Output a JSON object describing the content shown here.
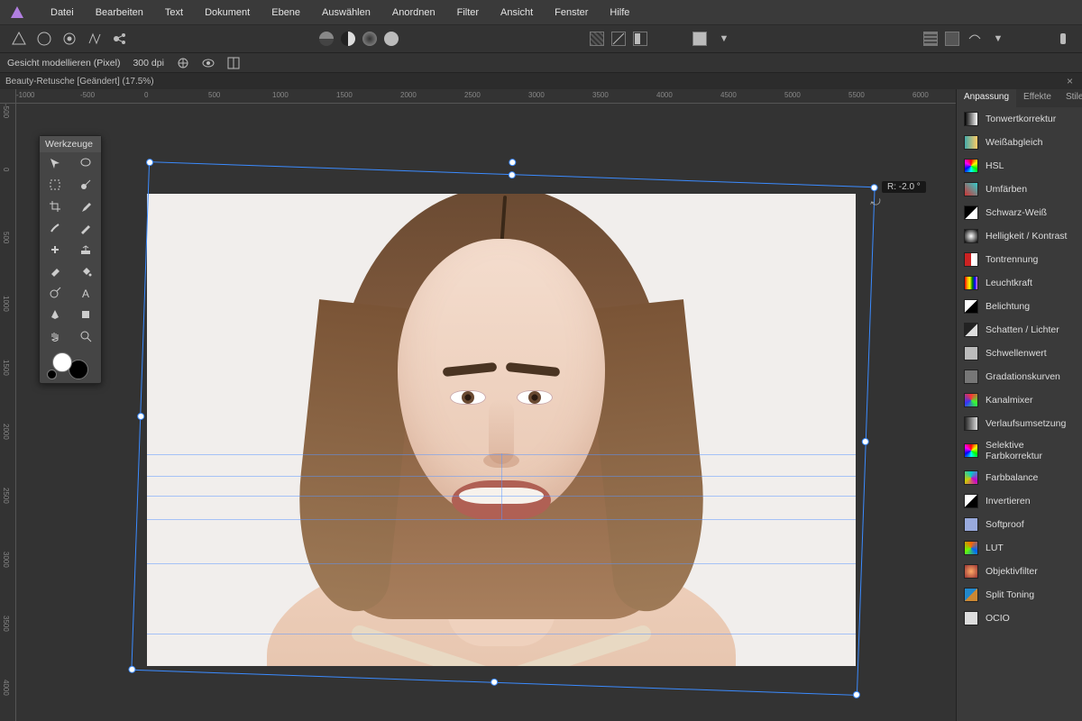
{
  "menu": {
    "items": [
      "Datei",
      "Bearbeiten",
      "Text",
      "Dokument",
      "Ebene",
      "Auswählen",
      "Anordnen",
      "Filter",
      "Ansicht",
      "Fenster",
      "Hilfe"
    ]
  },
  "context": {
    "label": "Gesicht modellieren (Pixel)",
    "dpi": "300 dpi"
  },
  "doc_tab": "Beauty-Retusche [Geändert] (17.5%)",
  "tools_panel_title": "Werkzeuge",
  "rotation_readout": "R:  -2.0 °",
  "ruler_h": [
    "-1000",
    "-500",
    "0",
    "500",
    "1000",
    "1500",
    "2000",
    "2500",
    "3000",
    "3500",
    "4000",
    "4500",
    "5000",
    "5500",
    "6000"
  ],
  "ruler_v": [
    "-500",
    "0",
    "500",
    "1000",
    "1500",
    "2000",
    "2500",
    "3000",
    "3500",
    "4000"
  ],
  "right_tabs": {
    "active": "Anpassung",
    "others": [
      "Effekte",
      "Stile"
    ]
  },
  "adjustments": [
    {
      "label": "Tonwertkorrektur",
      "iconColor": "linear-gradient(90deg,#000,#fff)"
    },
    {
      "label": "Weißabgleich",
      "iconColor": "linear-gradient(90deg,#4aa,#fc6)"
    },
    {
      "label": "HSL",
      "iconColor": "conic-gradient(red,yellow,lime,cyan,blue,magenta,red)"
    },
    {
      "label": "Umfärben",
      "iconColor": "linear-gradient(45deg,#c33,#3cc)"
    },
    {
      "label": "Schwarz-Weiß",
      "iconColor": "linear-gradient(135deg,#000 50%,#fff 50%)"
    },
    {
      "label": "Helligkeit / Kontrast",
      "iconColor": "radial-gradient(circle,#fff,#000)"
    },
    {
      "label": "Tontrennung",
      "iconColor": "linear-gradient(90deg,#c22 50%,#fff 50%)"
    },
    {
      "label": "Leuchtkraft",
      "iconColor": "linear-gradient(90deg,red,orange,yellow,green,blue,violet)"
    },
    {
      "label": "Belichtung",
      "iconColor": "linear-gradient(135deg,#fff 50%,#000 50%)"
    },
    {
      "label": "Schatten / Lichter",
      "iconColor": "linear-gradient(135deg,#222 50%,#ddd 50%)"
    },
    {
      "label": "Schwellenwert",
      "iconColor": "#bbb"
    },
    {
      "label": "Gradationskurven",
      "iconColor": "#777"
    },
    {
      "label": "Kanalmixer",
      "iconColor": "conic-gradient(#f33,#3f3,#33f,#f33)"
    },
    {
      "label": "Verlaufsumsetzung",
      "iconColor": "linear-gradient(90deg,#222,#ddd)"
    },
    {
      "label": "Selektive Farbkorrektur",
      "iconColor": "conic-gradient(red,yellow,lime,cyan,blue,magenta,red)"
    },
    {
      "label": "Farbbalance",
      "iconColor": "conic-gradient(#0cc,#c0c,#cc0,#0cc)"
    },
    {
      "label": "Invertieren",
      "iconColor": "linear-gradient(135deg,#fff 50%,#000 50%)"
    },
    {
      "label": "Softproof",
      "iconColor": "#9ad"
    },
    {
      "label": "LUT",
      "iconColor": "conic-gradient(#f60,#06f,#6f0,#f60)"
    },
    {
      "label": "Objektivfilter",
      "iconColor": "radial-gradient(circle,#fa6,#933)"
    },
    {
      "label": "Split Toning",
      "iconColor": "linear-gradient(135deg,#28c 50%,#c83 50%)"
    },
    {
      "label": "OCIO",
      "iconColor": "#ddd"
    }
  ],
  "colors": {
    "selection": "#3b8bff"
  }
}
